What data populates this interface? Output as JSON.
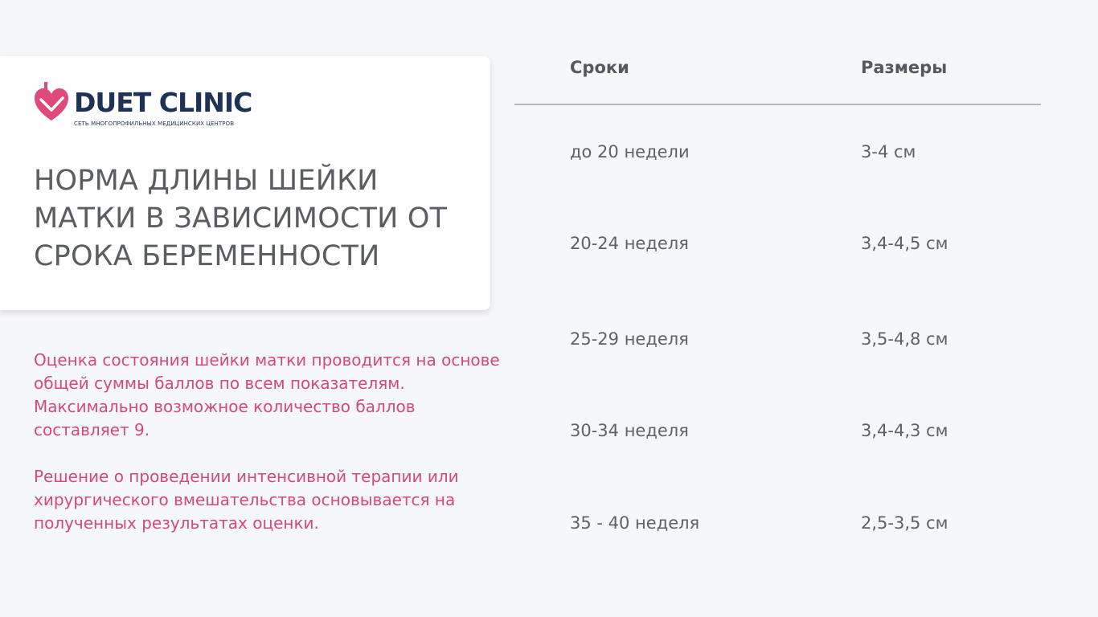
{
  "brand": {
    "name": "DUET CLINIC",
    "tagline": "СЕТЬ МНОГОПРОФИЛЬНЫХ МЕДИЦИНСКИХ ЦЕНТРОВ",
    "color": "#1e3256",
    "heart_color": "#e0497c"
  },
  "title": "НОРМА ДЛИНЫ ШЕЙКИ МАТКИ В ЗАВИСИМОСТИ ОТ СРОКА БЕРЕМЕННОСТИ",
  "description": [
    "Оценка состояния шейки матки проводится на основе общей суммы баллов по всем показателям. Максимально возможное количество баллов составляет 9.",
    "Решение о проведении интенсивной терапии или хирургического вмешательства основывается на полученных результатах оценки."
  ],
  "table": {
    "headers": [
      "Сроки",
      "Размеры"
    ],
    "rows": [
      [
        "до 20 недели",
        "3-4 см"
      ],
      [
        "20-24 неделя",
        "3,4-4,5 см"
      ],
      [
        "25-29 неделя",
        "3,5-4,8 см"
      ],
      [
        "30-34 неделя",
        "3,4-4,3 см"
      ],
      [
        "35 - 40 неделя",
        "2,5-3,5 см"
      ]
    ]
  },
  "colors": {
    "accent": "#d5487a",
    "title": "#5a5d62",
    "text": "#5e6166",
    "background": "#f6f7f9"
  }
}
